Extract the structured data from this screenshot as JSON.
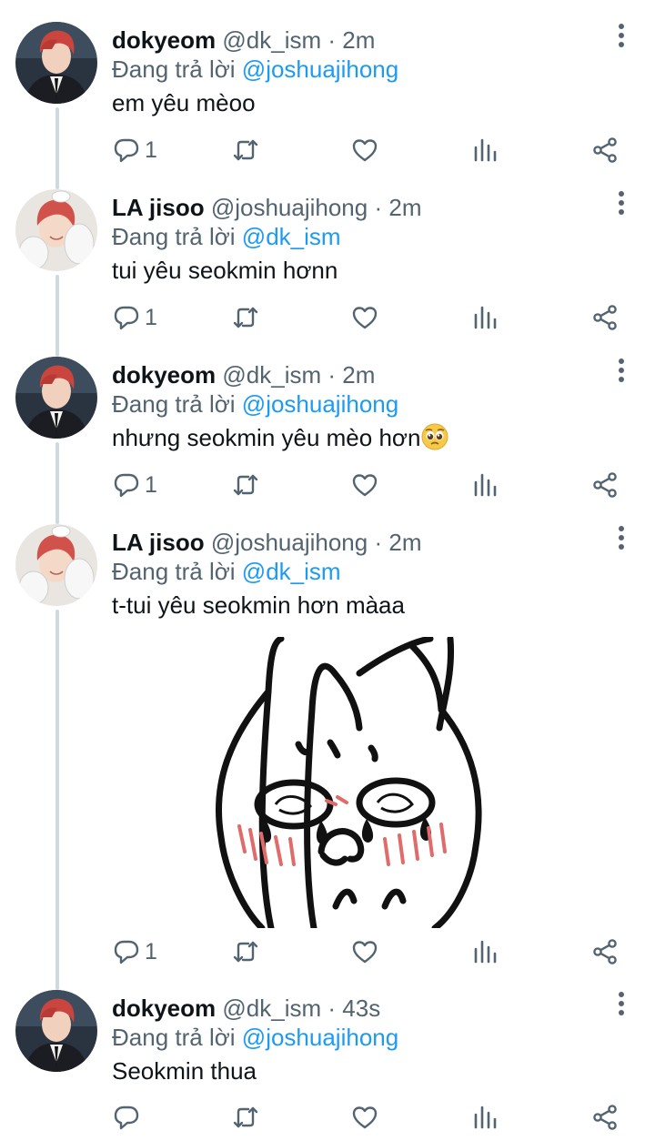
{
  "reply_prefix": "Đang trả lời",
  "tweets": [
    {
      "author": "dokyeom",
      "handle": "@dk_ism",
      "dot": "·",
      "time": "2m",
      "reply_to": "@joshuajihong",
      "text": "em yêu mèoo",
      "reply_count": "1",
      "avatar": "avatar-dokyeom"
    },
    {
      "author": "LA jisoo",
      "handle": "@joshuajihong",
      "dot": "·",
      "time": "2m",
      "reply_to": "@dk_ism",
      "text": "tui yêu seokmin hơnn",
      "reply_count": "1",
      "avatar": "avatar-jisoo"
    },
    {
      "author": "dokyeom",
      "handle": "@dk_ism",
      "dot": "·",
      "time": "2m",
      "reply_to": "@joshuajihong",
      "text": "nhưng seokmin yêu mèo hơn",
      "reply_count": "1",
      "emoji": "pleading-face-emoji",
      "avatar": "avatar-dokyeom"
    },
    {
      "author": "LA jisoo",
      "handle": "@joshuajihong",
      "dot": "·",
      "time": "2m",
      "reply_to": "@dk_ism",
      "text": "t-tui yêu seokmin hơn màaa",
      "reply_count": "1",
      "media": "crying-bunny-sticker",
      "avatar": "avatar-jisoo"
    },
    {
      "author": "dokyeom",
      "handle": "@dk_ism",
      "dot": "·",
      "time": "43s",
      "reply_to": "@joshuajihong",
      "text": "Seokmin thua",
      "reply_count": "",
      "avatar": "avatar-dokyeom"
    }
  ],
  "icons": {
    "reply": "reply-icon",
    "retweet": "retweet-icon",
    "like": "like-icon",
    "views": "views-icon",
    "share": "share-icon",
    "more": "more-icon"
  },
  "colors": {
    "text": "#0f1419",
    "muted": "#536471",
    "link": "#1d9bf0",
    "thread_line": "#cfd9de"
  }
}
